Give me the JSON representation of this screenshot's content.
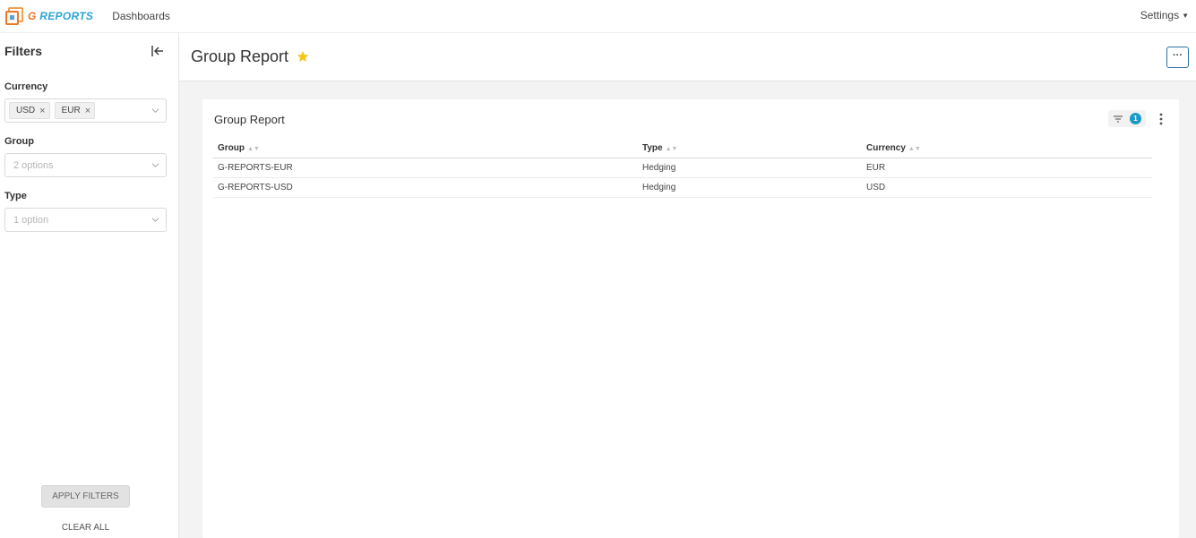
{
  "navbar": {
    "logo_text_g": "G",
    "logo_text_rest": "REPORTS",
    "dashboards_label": "Dashboards",
    "settings_label": "Settings"
  },
  "sidebar": {
    "title": "Filters",
    "currency": {
      "label": "Currency",
      "tags": [
        "USD",
        "EUR"
      ]
    },
    "group": {
      "label": "Group",
      "placeholder": "2 options"
    },
    "type": {
      "label": "Type",
      "placeholder": "1 option"
    },
    "apply_label": "APPLY FILTERS",
    "clear_label": "CLEAR ALL"
  },
  "header": {
    "title": "Group Report",
    "more_label": "···"
  },
  "card": {
    "title": "Group Report",
    "filter_count": "1",
    "table": {
      "columns": [
        "Group",
        "Type",
        "Currency"
      ],
      "rows": [
        [
          "G-REPORTS-EUR",
          "Hedging",
          "EUR"
        ],
        [
          "G-REPORTS-USD",
          "Hedging",
          "USD"
        ]
      ]
    }
  },
  "colors": {
    "accent_blue": "#2aa4d6",
    "brand_orange": "#e87b2a",
    "star_yellow": "#f5c518",
    "badge_blue": "#1a9ac8"
  }
}
